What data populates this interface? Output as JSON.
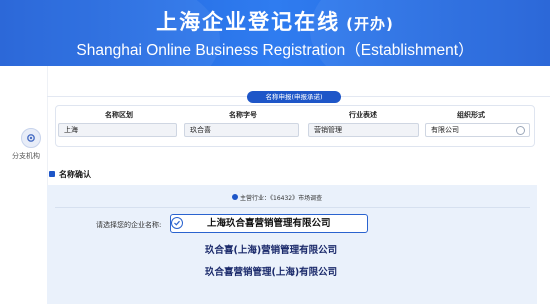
{
  "header": {
    "title": "上海企业登记在线",
    "title_suffix": "(开办)",
    "subtitle": "Shanghai Online Business Registration（Establishment）"
  },
  "sidebar": {
    "items": [
      {
        "label": "分支机构",
        "icon": "gear-icon"
      }
    ]
  },
  "name_application": {
    "tab_label": "名称申报(申报承诺)",
    "columns": [
      {
        "label": "名称区划",
        "value": "上海"
      },
      {
        "label": "名称字号",
        "value": "玖合喜"
      },
      {
        "label": "行业表述",
        "value": "营销管理"
      },
      {
        "label": "组织形式",
        "value": "有限公司"
      }
    ]
  },
  "confirmation": {
    "section_title": "名称确认",
    "industry_note": "主营行业：《16432》市场调查",
    "choose_label": "请选择您的企业名称:",
    "options": [
      {
        "text": "上海玖合喜营销管理有限公司",
        "selected": true
      },
      {
        "text": "玖合喜(上海)营销管理有限公司",
        "selected": false
      },
      {
        "text": "玖合喜营销管理(上海)有限公司",
        "selected": false
      }
    ]
  },
  "colors": {
    "banner": "#2f7cf0",
    "accent": "#1e56c8",
    "panel_bg": "#eaf1fb"
  }
}
